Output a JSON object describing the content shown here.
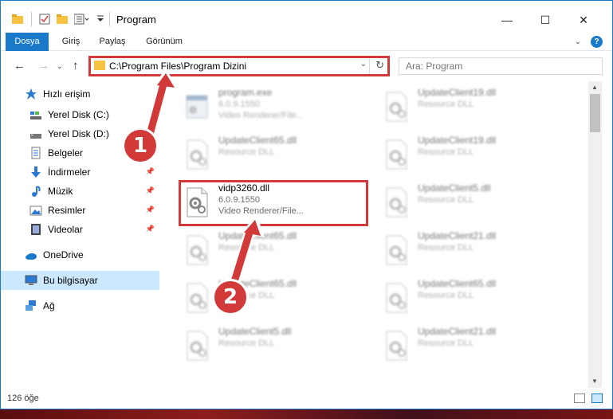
{
  "window": {
    "title": "Program",
    "controls": {
      "minimize": "—",
      "maximize": "☐",
      "close": "✕"
    }
  },
  "ribbon": {
    "tabs": [
      "Dosya",
      "Giriş",
      "Paylaş",
      "Görünüm"
    ],
    "help": "?"
  },
  "nav": {
    "address": "C:\\Program Files\\Program Dizini",
    "search_placeholder": "Ara: Program"
  },
  "sidebar": {
    "items": [
      {
        "label": "Hızlı erişim",
        "icon": "star-icon"
      },
      {
        "label": "Yerel Disk (C:)",
        "icon": "drive-icon"
      },
      {
        "label": "Yerel Disk (D:)",
        "icon": "drive-icon"
      },
      {
        "label": "Belgeler",
        "icon": "document-icon"
      },
      {
        "label": "İndirmeler",
        "icon": "download-icon"
      },
      {
        "label": "Müzik",
        "icon": "music-icon"
      },
      {
        "label": "Resimler",
        "icon": "pictures-icon"
      },
      {
        "label": "Videolar",
        "icon": "video-icon"
      },
      {
        "label": "OneDrive",
        "icon": "cloud-icon"
      },
      {
        "label": "Bu bilgisayar",
        "icon": "computer-icon"
      },
      {
        "label": "Ağ",
        "icon": "network-icon"
      }
    ]
  },
  "files": [
    {
      "name": "program.exe",
      "line1": "6.0.9.1550",
      "line2": "Video Renderer/File..."
    },
    {
      "name": "UpdateClient19.dll",
      "line1": "Resource DLL",
      "line2": ""
    },
    {
      "name": "UpdateClient65.dll",
      "line1": "Resource DLL",
      "line2": ""
    },
    {
      "name": "UpdateClient19.dll",
      "line1": "Resource DLL",
      "line2": ""
    },
    {
      "name": "vidp3260.dll",
      "line1": "6.0.9.1550",
      "line2": "Video Renderer/File..."
    },
    {
      "name": "UpdateClient5.dll",
      "line1": "Resource DLL",
      "line2": ""
    },
    {
      "name": "UpdateClient65.dll",
      "line1": "Resource DLL",
      "line2": ""
    },
    {
      "name": "UpdateClient21.dll",
      "line1": "Resource DLL",
      "line2": ""
    },
    {
      "name": "UpdateClient65.dll",
      "line1": "Resource DLL",
      "line2": ""
    },
    {
      "name": "UpdateClient65.dll",
      "line1": "Resource DLL",
      "line2": ""
    },
    {
      "name": "UpdateClient5.dll",
      "line1": "Resource DLL",
      "line2": ""
    },
    {
      "name": "UpdateClient21.dll",
      "line1": "Resource DLL",
      "line2": ""
    }
  ],
  "status": {
    "count": "126 öğe"
  },
  "annotations": {
    "step1": "1",
    "step2": "2"
  },
  "colors": {
    "accent": "#1979ca",
    "annotation": "#d23a3a",
    "selected": "#cce8ff"
  }
}
